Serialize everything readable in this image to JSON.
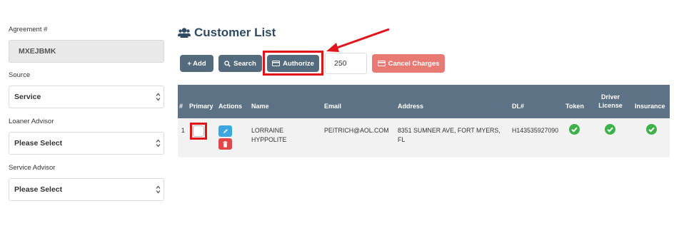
{
  "form": {
    "agreement_label": "Agreement #",
    "agreement_value": "MXEJBMK",
    "source_label": "Source",
    "source_value": "Service",
    "loaner_label": "Loaner Advisor",
    "loaner_value": "Please Select",
    "service_label": "Service Advisor",
    "service_value": "Please Select"
  },
  "header": {
    "title": "Customer List",
    "icon": "users-icon"
  },
  "toolbar": {
    "add_label": "+ Add",
    "search_label": "Search",
    "authorize_label": "Authorize",
    "amount_value": "250",
    "cancel_label": "Cancel Charges"
  },
  "table": {
    "headers": {
      "num": "#",
      "primary": "Primary",
      "actions": "Actions",
      "name": "Name",
      "email": "Email",
      "address": "Address",
      "dl": "DL#",
      "token": "Token",
      "driver_license": "Driver License",
      "insurance": "Insurance"
    },
    "rows": [
      {
        "num": "1",
        "name": "LORRAINE HYPPOLITE",
        "email": "PEITRICH@AOL.COM",
        "address": "8351 SUMNER AVE, FORT MYERS, FL",
        "dl": "H143535927090",
        "token": true,
        "driver_license": true,
        "insurance": true
      }
    ]
  },
  "colors": {
    "header_bg": "#5d7385",
    "button_dark": "#546b7d",
    "cancel_button": "#e87a73",
    "check_green": "#3db24b",
    "highlight_red": "#e0141b",
    "title": "#2f4a62"
  }
}
